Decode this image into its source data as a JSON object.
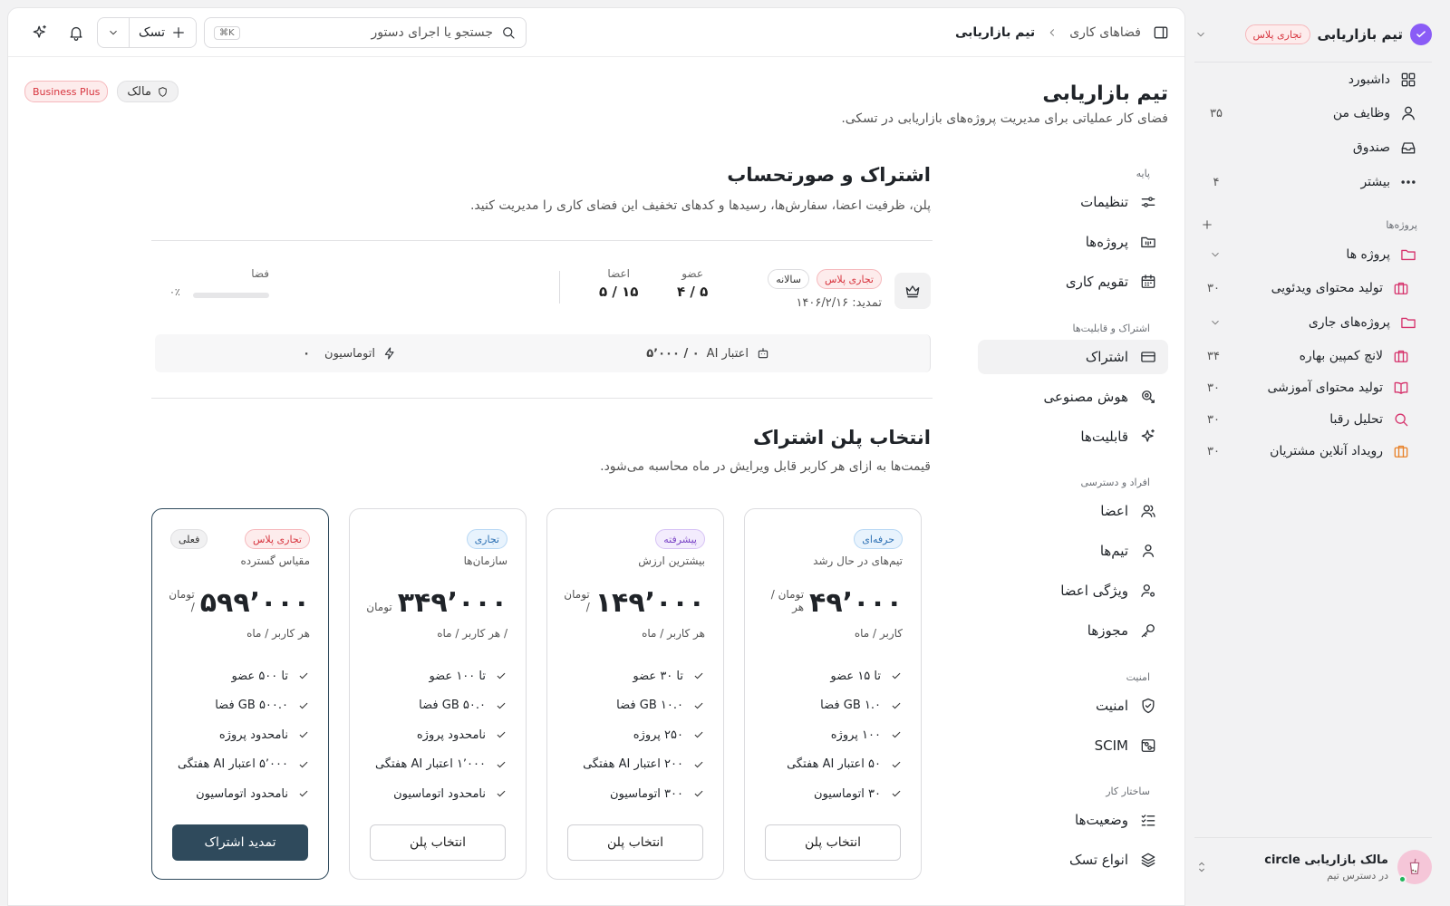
{
  "sidebar": {
    "workspace_name": "تیم بازاریابی",
    "workspace_badge": "تجاری پلاس",
    "nav": [
      {
        "label": "داشبورد",
        "count": ""
      },
      {
        "label": "وظایف من",
        "count": "۳۵"
      },
      {
        "label": "صندوق",
        "count": ""
      },
      {
        "label": "بیشتر",
        "count": "۴"
      }
    ],
    "projects_section": "پروژه‌ها",
    "folders": [
      {
        "label": "پروژه ها"
      },
      {
        "label": "پروژه‌های جاری"
      }
    ],
    "projects": [
      {
        "label": "تولید محتوای ویدئویی",
        "count": "۳۰"
      },
      {
        "label": "لانچ کمپین بهاره",
        "count": "۳۴"
      },
      {
        "label": "تولید محتوای آموزشی",
        "count": "۳۰"
      },
      {
        "label": "تحلیل رقبا",
        "count": "۳۰"
      },
      {
        "label": "رویداد آنلاین مشتریان",
        "count": "۳۰"
      }
    ],
    "user": {
      "name": "مالک بازاریابی circle",
      "status": "در دسترس تیم"
    }
  },
  "topbar": {
    "breadcrumb_parent": "فضاهای کاری",
    "breadcrumb_current": "تیم بازاریابی",
    "search_placeholder": "جستجو یا اجرای دستور",
    "search_shortcut": "⌘K",
    "task_button": "تسک"
  },
  "header": {
    "title": "تیم بازاریابی",
    "description": "فضای کار عملیاتی برای مدیریت پروژه‌های بازاریابی در تسکی.",
    "plan_badge": "Business Plus",
    "role_badge": "مالک"
  },
  "settings_nav": {
    "sections": [
      {
        "title": "پایه",
        "items": [
          "تنظیمات",
          "پروژه‌ها",
          "تقویم کاری"
        ]
      },
      {
        "title": "اشتراک و قابلیت‌ها",
        "items": [
          "اشتراک",
          "هوش مصنوعی",
          "قابلیت‌ها"
        ]
      },
      {
        "title": "افراد و دسترسی",
        "items": [
          "اعضا",
          "تیم‌ها",
          "ویژگی اعضا",
          "مجوزها"
        ]
      },
      {
        "title": "امنیت",
        "items": [
          "امنیت",
          "SCIM"
        ]
      },
      {
        "title": "ساختار کار",
        "items": [
          "وضعیت‌ها",
          "انواع تسک"
        ]
      }
    ],
    "active": "اشتراک"
  },
  "subscription": {
    "title": "اشتراک و صورتحساب",
    "description": "پلن، ظرفیت اعضا، سفارش‌ها، رسیدها و کدهای تخفیف این فضای کاری را مدیریت کنید.",
    "plan_badge": "تجاری پلاس",
    "cycle_badge": "سالانه",
    "renewal": "تمدید: ۱۴۰۶/۲/۱۶",
    "stats": [
      {
        "label": "عضو",
        "value": "۴ / ۵"
      },
      {
        "label": "اعضا",
        "value": "۵ / ۱۵"
      }
    ],
    "storage_label": "فضا",
    "storage_percent": 0,
    "storage_percent_text": "۰٪",
    "ai_credit_label": "اعتبار AI",
    "ai_credit_value": "۰ / ۵٬۰۰۰",
    "automation_label": "اتوماسیون",
    "automation_value": "۰"
  },
  "plans_section": {
    "title": "انتخاب پلن اشتراک",
    "description": "قیمت‌ها به ازای هر کاربر قابل ویرایش در ماه محاسبه می‌شود."
  },
  "plans": [
    {
      "tier": "حرفه‌ای",
      "tagline": "تیم‌های در حال رشد",
      "price": "۴۹٬۰۰۰",
      "unit": "تومان / هر",
      "per": "کاربر / ماه",
      "features": [
        "تا ۱۵ عضو",
        "۱.۰ GB فضا",
        "۱۰۰ پروژه",
        "۵۰ اعتبار AI هفتگی",
        "۳۰ اتوماسیون"
      ],
      "button": "انتخاب پلن",
      "current_tag": ""
    },
    {
      "tier": "پیشرفته",
      "tagline": "بیشترین ارزش",
      "price": "۱۴۹٬۰۰۰",
      "unit": "تومان /",
      "per": "هر کاربر / ماه",
      "features": [
        "تا ۳۰ عضو",
        "۱۰.۰ GB فضا",
        "۲۵۰ پروژه",
        "۲۰۰ اعتبار AI هفتگی",
        "۳۰۰ اتوماسیون"
      ],
      "button": "انتخاب پلن",
      "current_tag": ""
    },
    {
      "tier": "تجاری",
      "tagline": "سازمان‌ها",
      "price": "۳۴۹٬۰۰۰",
      "unit": "تومان",
      "per": "/ هر کاربر / ماه",
      "features": [
        "تا ۱۰۰ عضو",
        "۵۰.۰ GB فضا",
        "نامحدود پروژه",
        "۱٬۰۰۰ اعتبار AI هفتگی",
        "نامحدود اتوماسیون"
      ],
      "button": "انتخاب پلن",
      "current_tag": ""
    },
    {
      "tier": "تجاری پلاس",
      "tagline": "مقیاس گسترده",
      "price": "۵۹۹٬۰۰۰",
      "unit": "تومان /",
      "per": "هر کاربر / ماه",
      "features": [
        "تا ۵۰۰ عضو",
        "۵۰۰.۰ GB فضا",
        "نامحدود پروژه",
        "۵٬۰۰۰ اعتبار AI هفتگی",
        "نامحدود اتوماسیون"
      ],
      "button": "تمدید اشتراک",
      "current_tag": "فعلی"
    }
  ],
  "colors": {
    "accent": "#2f4a5c",
    "danger": "#d7343e"
  }
}
